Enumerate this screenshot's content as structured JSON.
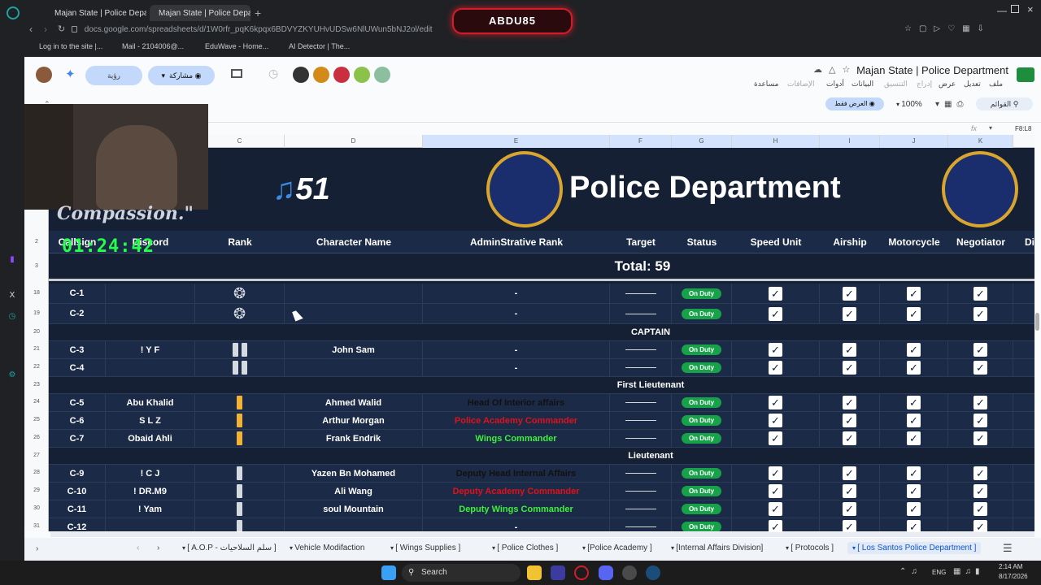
{
  "browser": {
    "tabs": [
      {
        "label": "Majan State | Police Depar",
        "active": false
      },
      {
        "label": "Majan State | Police Depar",
        "active": true
      }
    ],
    "url": "docs.google.com/spreadsheets/d/1W0rfr_pqK6kpqx6BDVYZKYUHvUDSw6NlUWun5bNJ2ol/edit",
    "bookmarks": [
      "Log in to the site |...",
      "Mail - 2104006@...",
      "EduWave - Home...",
      "AI Detector | The..."
    ],
    "streamer_name": "ABDU85"
  },
  "sheets": {
    "doc_title": "Majan State | Police Department",
    "menus": [
      "ملف",
      "تعديل",
      "عرض",
      "إدراج",
      "التنسيق",
      "البيانات",
      "أدوات",
      "الإضافات",
      "مساعدة"
    ],
    "share_label": "مشاركة",
    "chip_label": "رؤية",
    "view_only_label": "العرض فقط",
    "zoom": "100%",
    "search_menus_label": "القوائم",
    "cell_ref": "F8:L8",
    "fx": "fx"
  },
  "overlay": {
    "timer": "01:24:42",
    "motto": "Compassion.\""
  },
  "columns": [
    "C",
    "D",
    "E",
    "F",
    "G",
    "H",
    "I",
    "J",
    "K"
  ],
  "banner": {
    "title": "Police Department",
    "logo_text": "51"
  },
  "table": {
    "headers": [
      "Callsign",
      "Discord",
      "Rank",
      "Character Name",
      "AdminStrative Rank",
      "Target",
      "Status",
      "Speed Unit",
      "Airship",
      "Motorcycle",
      "Negotiator",
      "Di"
    ],
    "total": "Total: 59",
    "rows": [
      {
        "num": "18",
        "callsign": "C-1",
        "discord": "",
        "rank": "eagle",
        "name": "",
        "admin": "-",
        "status": "On Duty"
      },
      {
        "num": "19",
        "callsign": "C-2",
        "discord": "",
        "rank": "eagle",
        "name": "",
        "admin": "-",
        "status": "On Duty"
      },
      {
        "num": "20",
        "section": "CAPTAIN"
      },
      {
        "num": "21",
        "callsign": "C-3",
        "discord": "! Y F",
        "rank": "silver2",
        "name": "John Sam",
        "admin": "-",
        "status": "On Duty"
      },
      {
        "num": "22",
        "callsign": "C-4",
        "discord": "",
        "rank": "silver2",
        "name": "",
        "admin": "-",
        "status": "On Duty"
      },
      {
        "num": "23",
        "section": "First Lieutenant"
      },
      {
        "num": "24",
        "callsign": "C-5",
        "discord": "Abu Khalid",
        "rank": "gold",
        "name": "Ahmed Walid",
        "admin": "Head Of Interior affairs",
        "admin_color": "#111111",
        "status": "On Duty"
      },
      {
        "num": "25",
        "callsign": "C-6",
        "discord": "S L Z",
        "rank": "gold",
        "name": "Arthur Morgan",
        "admin": "Police Academy Commander",
        "admin_color": "#e0111b",
        "status": "On Duty"
      },
      {
        "num": "26",
        "callsign": "C-7",
        "discord": "Obaid Ahli",
        "rank": "gold",
        "name": "Frank Endrik",
        "admin": "Wings Commander",
        "admin_color": "#3cf03c",
        "status": "On Duty"
      },
      {
        "num": "27",
        "section": "Lieutenant"
      },
      {
        "num": "28",
        "callsign": "C-9",
        "discord": "! C J",
        "rank": "silver1",
        "name": "Yazen Bn Mohamed",
        "admin": "Deputy Head Internal Affairs",
        "admin_color": "#111111",
        "status": "On Duty"
      },
      {
        "num": "29",
        "callsign": "C-10",
        "discord": "! DR.M9",
        "rank": "silver1",
        "name": "Ali Wang",
        "admin": "Deputy Academy Commander",
        "admin_color": "#e0111b",
        "status": "On Duty"
      },
      {
        "num": "30",
        "callsign": "C-11",
        "discord": "! Yam",
        "rank": "silver1",
        "name": "soul Mountain",
        "admin": "Deputy Wings Commander",
        "admin_color": "#3cf03c",
        "status": "On Duty"
      },
      {
        "num": "31",
        "callsign": "C-12",
        "discord": "",
        "rank": "silver1",
        "name": "",
        "admin": "-",
        "status": "On Duty"
      }
    ]
  },
  "sheet_tabs": [
    "[ A.O.P - سلم السلاحيات ]",
    "Vehicle Modifaction",
    "[ Wings Supplies ]",
    "[ Police Clothes ]",
    "[Police Academy ]",
    "[Internal Affairs Division]",
    "[ Protocols ]",
    "[ Los Santos Police Department ]"
  ],
  "taskbar": {
    "search": "Search",
    "lang": "ENG",
    "time": "2:14 AM",
    "date": "8/17/2026"
  }
}
